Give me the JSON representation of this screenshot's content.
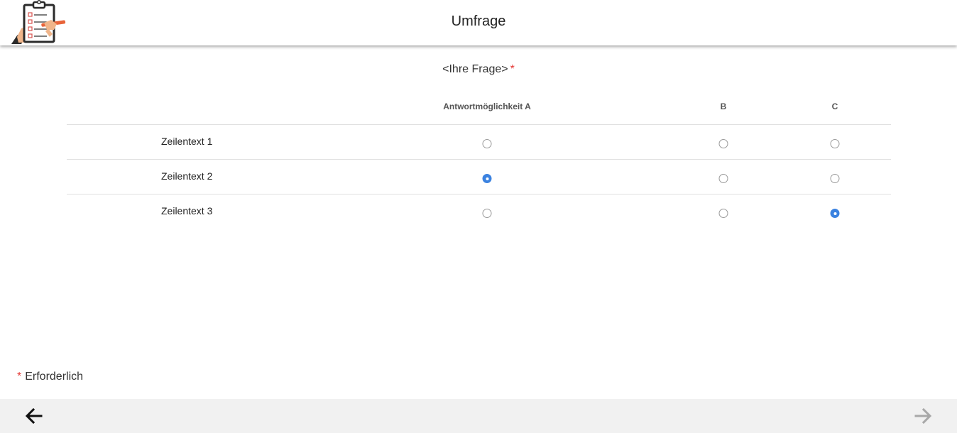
{
  "header": {
    "title": "Umfrage",
    "logo_icon": "clipboard-survey-icon"
  },
  "question": {
    "text": "<Ihre Frage>",
    "required_mark": "*"
  },
  "matrix": {
    "columns": [
      "Antwortmöglichkeit A",
      "B",
      "C"
    ],
    "rows": [
      {
        "label": "Zeilentext 1",
        "selected": null
      },
      {
        "label": "Zeilentext 2",
        "selected": "Antwortmöglichkeit A"
      },
      {
        "label": "Zeilentext 3",
        "selected": "C"
      }
    ]
  },
  "footer": {
    "required_mark": "*",
    "required_label": "Erforderlich",
    "back_icon": "arrow-left-icon",
    "next_icon": "arrow-right-icon",
    "next_enabled": false
  },
  "colors": {
    "accent": "#3b82e0",
    "required": "#e53935",
    "footer_bg": "#f1f1f1"
  }
}
